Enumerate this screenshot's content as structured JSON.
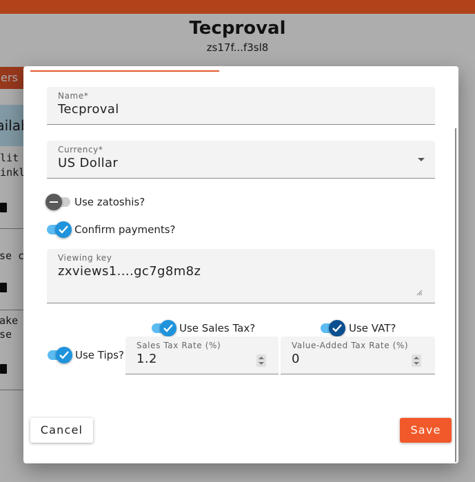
{
  "background": {
    "title": "Tecproval",
    "address": "zs17f...f3sl8",
    "orders_tab": "Orders",
    "available_label": "Available",
    "card1_line1": "Split",
    "card1_line2": "Drinkl",
    "card2_line1": "Use ch",
    "card3_line1": "Make",
    "card3_line2": "Use"
  },
  "dialog": {
    "name": {
      "label": "Name*",
      "value": "Tecproval"
    },
    "currency": {
      "label": "Currency*",
      "value": "US Dollar"
    },
    "use_zatoshis": {
      "label": "Use zatoshis?",
      "checked": false
    },
    "confirm_payments": {
      "label": "Confirm payments?",
      "checked": true
    },
    "viewing_key": {
      "label": "Viewing key",
      "value": "zxviews1....gc7g8m8z"
    },
    "use_sales_tax": {
      "label": "Use Sales Tax?",
      "checked": true
    },
    "use_vat": {
      "label": "Use VAT?",
      "checked": true
    },
    "use_tips": {
      "label": "Use Tips?",
      "checked": true
    },
    "sales_tax_rate": {
      "label": "Sales Tax Rate (%)",
      "value": "1.2"
    },
    "vat_rate": {
      "label": "Value-Added Tax Rate (%)",
      "value": "0"
    },
    "cancel_label": "Cancel",
    "save_label": "Save"
  },
  "colors": {
    "brand": "#b1431a",
    "accent": "#f2592a",
    "toggle_track_on": "#5cbcf2",
    "toggle_thumb_on": "#1f93dc",
    "toggle_thumb_dark": "#0a4f8f"
  }
}
